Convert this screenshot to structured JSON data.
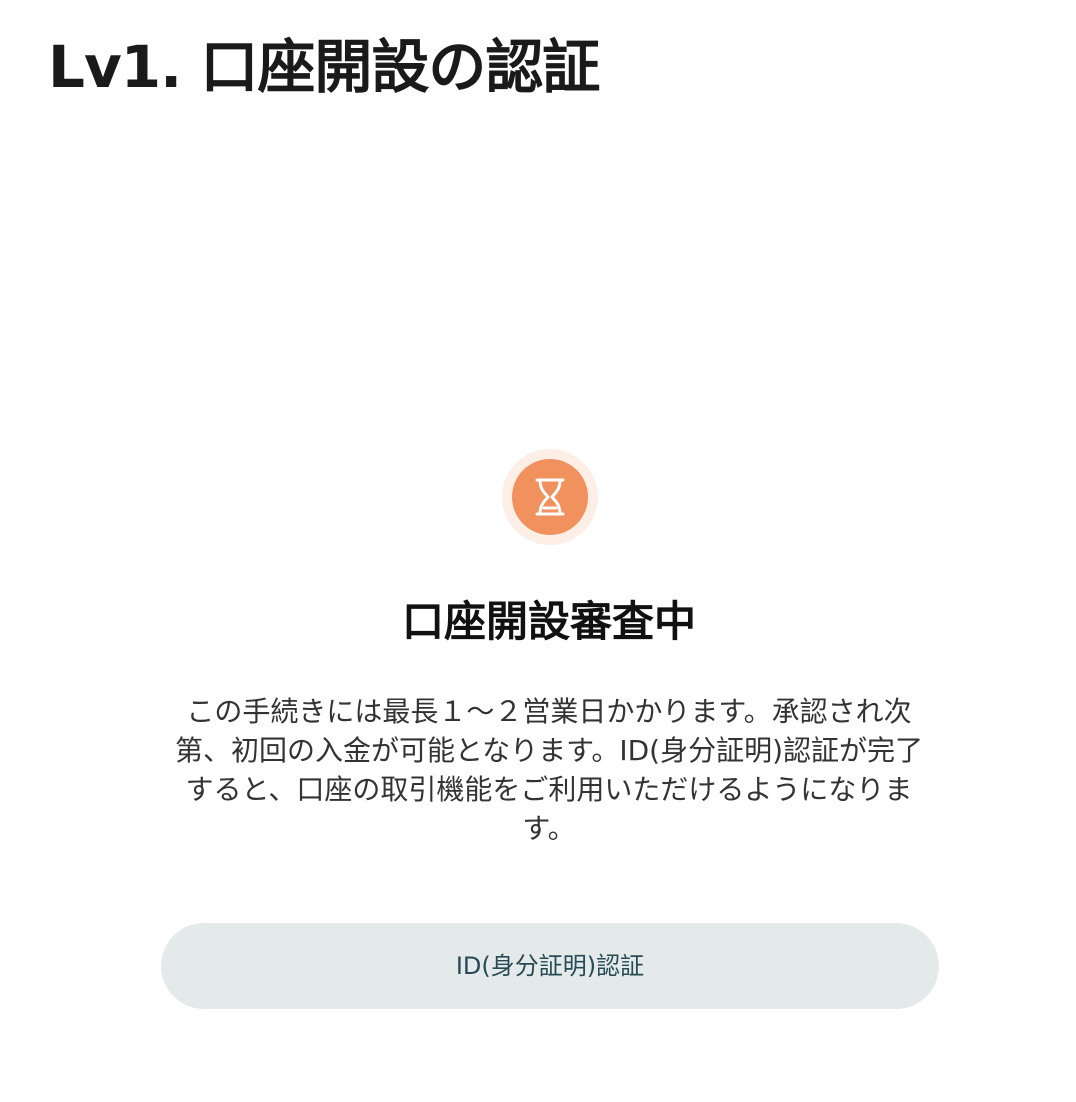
{
  "header": {
    "title": "Lv1. 口座開設の認証"
  },
  "status": {
    "icon": "hourglass-icon",
    "icon_color": "#f0915e",
    "icon_bg_color": "#fdeee6",
    "heading": "口座開設審査中",
    "description": "この手続きには最長１〜２営業日かかります。承認され次第、初回の入金が可能となります。ID(身分証明)認証が完了すると、口座の取引機能をご利用いただけるようになります。"
  },
  "actions": {
    "id_verify_label": "ID(身分証明)認証",
    "id_verify_bg": "#e4eaea",
    "id_verify_text_color": "#274a55"
  }
}
